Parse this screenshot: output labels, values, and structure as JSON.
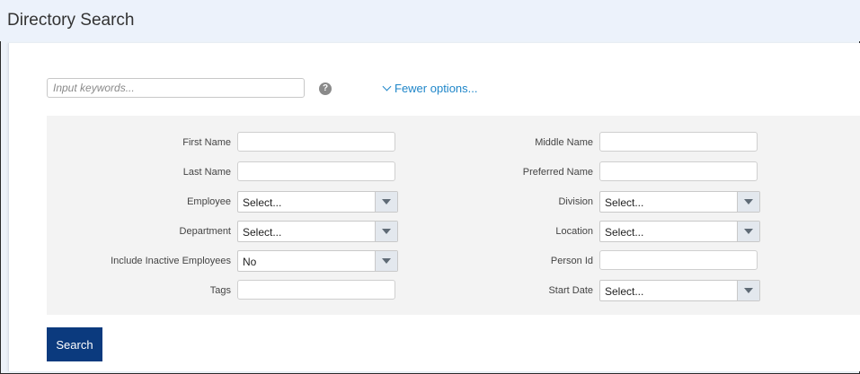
{
  "page": {
    "title": "Directory Search"
  },
  "search": {
    "keywords_placeholder": "Input keywords...",
    "keywords_value": "",
    "help_glyph": "?",
    "fewer_options_label": "Fewer options..."
  },
  "fields": {
    "first_name": {
      "label": "First Name",
      "value": ""
    },
    "last_name": {
      "label": "Last Name",
      "value": ""
    },
    "employee": {
      "label": "Employee",
      "value": "Select..."
    },
    "department": {
      "label": "Department",
      "value": "Select..."
    },
    "include_inactive": {
      "label": "Include Inactive Employees",
      "value": "No"
    },
    "tags": {
      "label": "Tags",
      "value": ""
    },
    "middle_name": {
      "label": "Middle Name",
      "value": ""
    },
    "preferred_name": {
      "label": "Preferred Name",
      "value": ""
    },
    "division": {
      "label": "Division",
      "value": "Select..."
    },
    "location": {
      "label": "Location",
      "value": "Select..."
    },
    "person_id": {
      "label": "Person Id",
      "value": ""
    },
    "start_date": {
      "label": "Start Date",
      "value": "Select..."
    }
  },
  "actions": {
    "search_label": "Search"
  },
  "colors": {
    "accent_link": "#1f86c9",
    "search_button": "#0b3a7e",
    "title_bar": "#ecf2fb",
    "options_panel": "#f3f3f3"
  },
  "icons": {
    "help": "question-circle-icon",
    "fewer_options": "chevron-down-icon",
    "dropdown": "caret-down-icon"
  }
}
